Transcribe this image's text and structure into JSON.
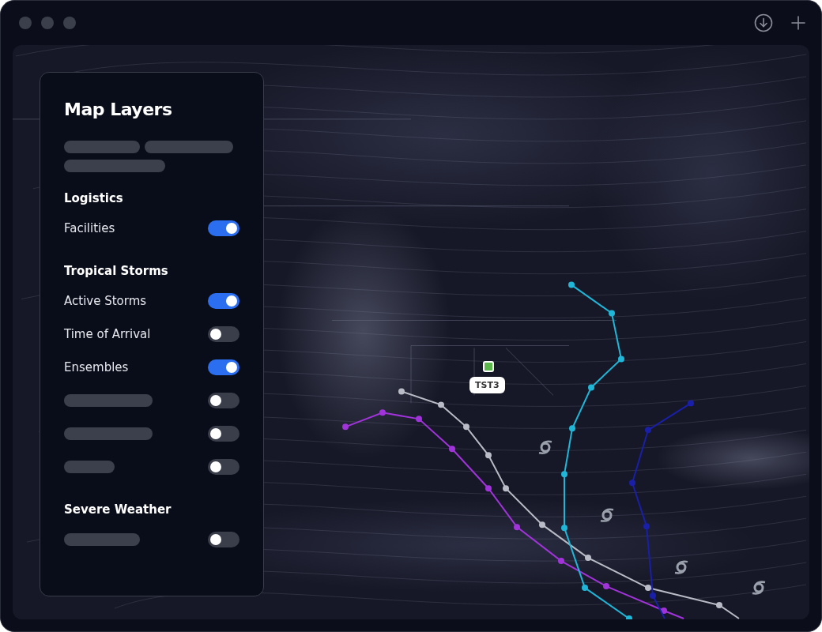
{
  "panel": {
    "title": "Map Layers",
    "sections": [
      {
        "title": "Logistics",
        "layers": [
          {
            "kind": "text",
            "label": "Facilities",
            "on": true
          }
        ]
      },
      {
        "title": "Tropical Storms",
        "layers": [
          {
            "kind": "text",
            "label": "Active Storms",
            "on": true
          },
          {
            "kind": "text",
            "label": "Time of Arrival",
            "on": false
          },
          {
            "kind": "text",
            "label": "Ensembles",
            "on": true
          },
          {
            "kind": "skeleton",
            "on": false
          },
          {
            "kind": "skeleton",
            "on": false
          },
          {
            "kind": "skeleton",
            "on": false
          }
        ]
      },
      {
        "title": "Severe Weather",
        "layers": [
          {
            "kind": "skeleton",
            "on": false
          }
        ]
      }
    ]
  },
  "map": {
    "facility": {
      "label": "TST3"
    },
    "tracks": [
      {
        "color": "#b9bcc6"
      },
      {
        "color": "#a034d8"
      },
      {
        "color": "#1fb6d8"
      },
      {
        "color": "#1a1fa8"
      }
    ]
  }
}
